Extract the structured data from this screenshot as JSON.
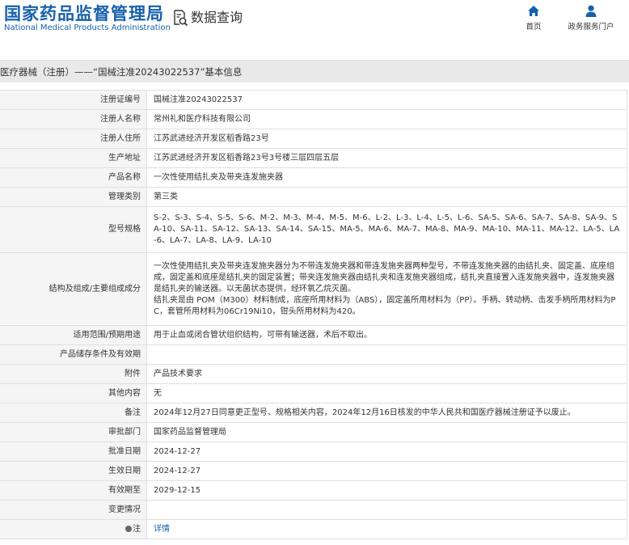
{
  "header": {
    "logo_title": "国家药品监督管理局",
    "logo_subtitle": "National Medical Products Administration",
    "query_icon": "search-document-icon",
    "query_label": "数据查询",
    "nav": [
      {
        "label": "首页",
        "icon": "home-icon"
      },
      {
        "label": "政务服务门户",
        "icon": "user-icon"
      }
    ],
    "brand_color": "#1661ab"
  },
  "title_bar": {
    "text": "医疗器械（注册）——“国械注准20243022537”基本信息"
  },
  "fields": [
    {
      "label": "注册证编号",
      "value": "国械注准20243022537"
    },
    {
      "label": "注册人名称",
      "value": "常州礼和医疗科技有限公司"
    },
    {
      "label": "注册人住所",
      "value": "江苏武进经济开发区稻香路23号"
    },
    {
      "label": "生产地址",
      "value": "江苏武进经济开发区稻香路23号3号楼三层四层五层"
    },
    {
      "label": "产品名称",
      "value": "一次性使用结扎夹及带夹连发施夹器"
    },
    {
      "label": "管理类别",
      "value": "第三类"
    },
    {
      "label": "型号规格",
      "value": "S-2、S-3、S-4、S-5、S-6、M-2、M-3、M-4、M-5、M-6、L-2、L-3、L-4、L-5、L-6、SA-5、SA-6、SA-7、SA-8、SA-9、SA-10、SA-11、SA-12、SA-13、SA-14、SA-15、MA-5、MA-6、MA-7、MA-8、MA-9、MA-10、MA-11、MA-12、LA-5、LA-6、LA-7、LA-8、LA-9、LA-10"
    },
    {
      "label": "结构及组成/主要组成成分",
      "value_lines": [
        "一次性使用结扎夹及带夹连发施夹器分为不带连发施夹器和带连发施夹器两种型号，不带连发施夹器的由结扎夹、固定盖、底座组成，固定盖和底座是结扎夹的固定装置；带夹连发施夹器由结扎夹和连发施夹器组成，结扎夹直接置入连发施夹器中，连发施夹器是结扎夹的输送器。以无菌状态提供，经环氧乙烷灭菌。",
        "结扎夹是由 POM（M300）材料制成，底座所用材料为（ABS），固定盖所用材料为（PP）。手柄、转动柄、击发手柄所用材料为PC，套管所用材料为06Cr19Ni10，钳头所用材料为420。"
      ]
    },
    {
      "label": "适用范围/预期用途",
      "value": "用于止血或闭合管状组织结构，可带有输送器，术后不取出。"
    },
    {
      "label": "产品储存条件及有效期",
      "value": ""
    },
    {
      "label": "附件",
      "value": "产品技术要求"
    },
    {
      "label": "其他内容",
      "value": "无"
    },
    {
      "label": "备注",
      "value": "2024年12月27日同意更正型号、规格相关内容，2024年12月16日核发的中华人民共和国医疗器械注册证予以废止。"
    },
    {
      "label": "审批部门",
      "value": "国家药品监督管理局"
    },
    {
      "label": "批准日期",
      "value": "2024-12-27"
    },
    {
      "label": "生效日期",
      "value": "2024-12-27"
    },
    {
      "label": "有效期至",
      "value": "2029-12-15"
    },
    {
      "label": "变更情况",
      "value": ""
    },
    {
      "label": "注",
      "icon": "info-dot-icon",
      "link_text": "详情"
    }
  ]
}
